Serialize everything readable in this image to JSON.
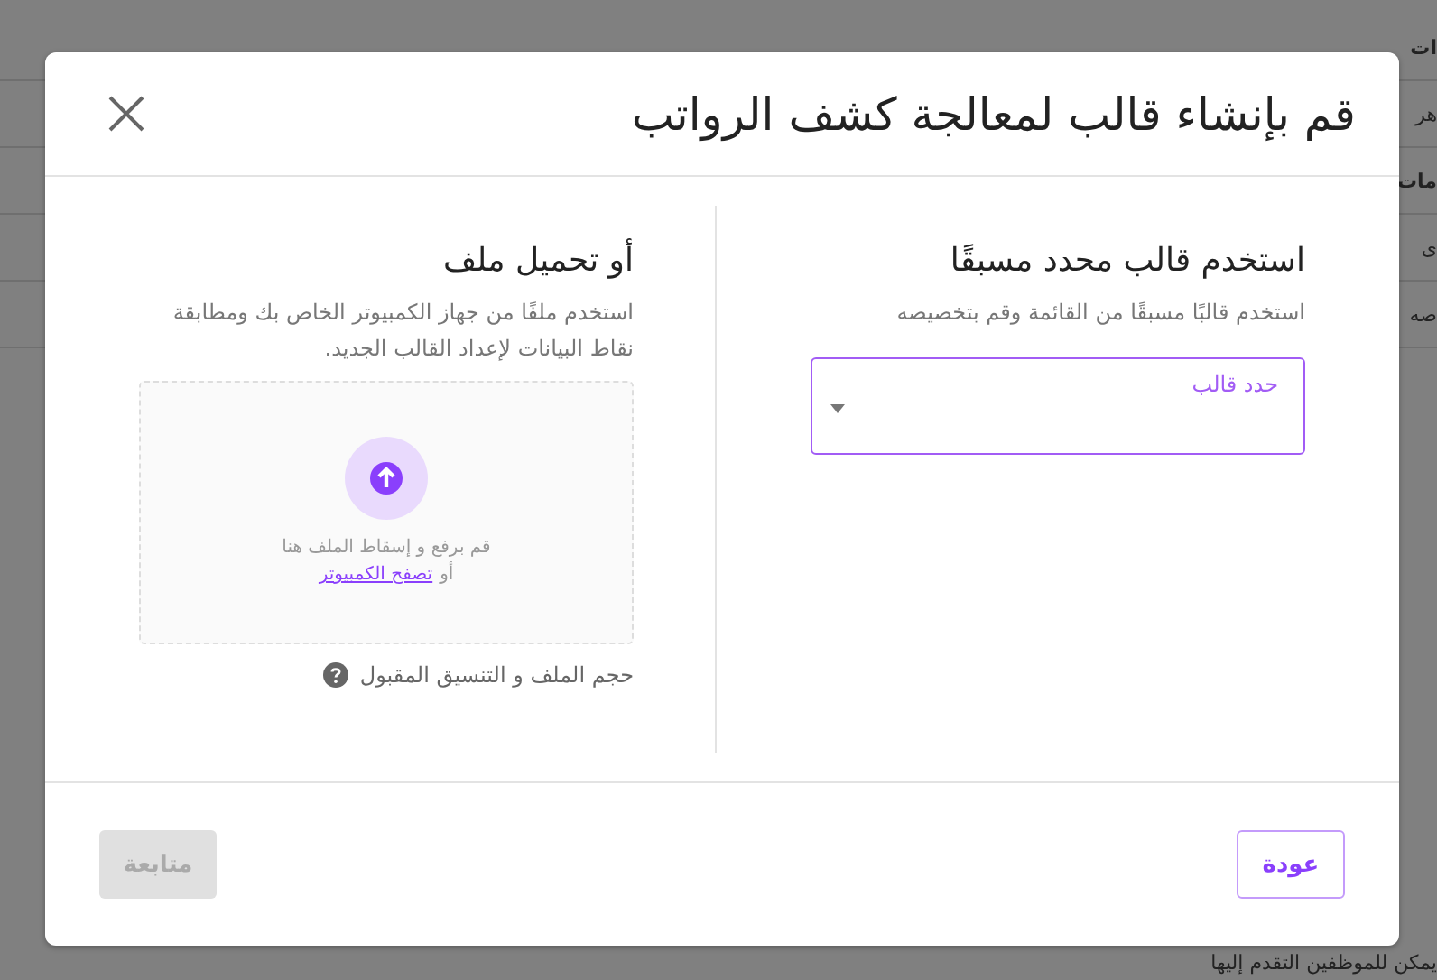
{
  "background": {
    "fragments": [
      {
        "text": "ات",
        "bold": true
      },
      {
        "text": "هر",
        "bold": false
      },
      {
        "text": "مات",
        "bold": true
      },
      {
        "text": "ى",
        "bold": false
      },
      {
        "text": "صه",
        "bold": false
      }
    ],
    "footer_text": "يمكن للموظفين التقدم إليها"
  },
  "dialog": {
    "title": "قم بإنشاء قالب لمعالجة كشف الرواتب",
    "template_section": {
      "heading": "استخدم قالب محدد مسبقًا",
      "description": "استخدم قالبًا مسبقًا من القائمة وقم بتخصيصه",
      "select": {
        "label": "حدد قالب"
      }
    },
    "upload_section": {
      "heading": "أو تحميل ملف",
      "description": "استخدم ملفًا من جهاز الكمبيوتر الخاص بك ومطابقة نقاط البيانات لإعداد القالب الجديد.",
      "dropzone": {
        "line1": "قم برفع و إسقاط الملف هنا",
        "prefix": "أو",
        "link": "تصفح الكمبيوتر"
      },
      "help": "حجم الملف و التنسيق المقبول"
    },
    "buttons": [
      {
        "label": "عودة",
        "disabled": false
      },
      {
        "label": "متابعة",
        "disabled": true
      }
    ]
  }
}
